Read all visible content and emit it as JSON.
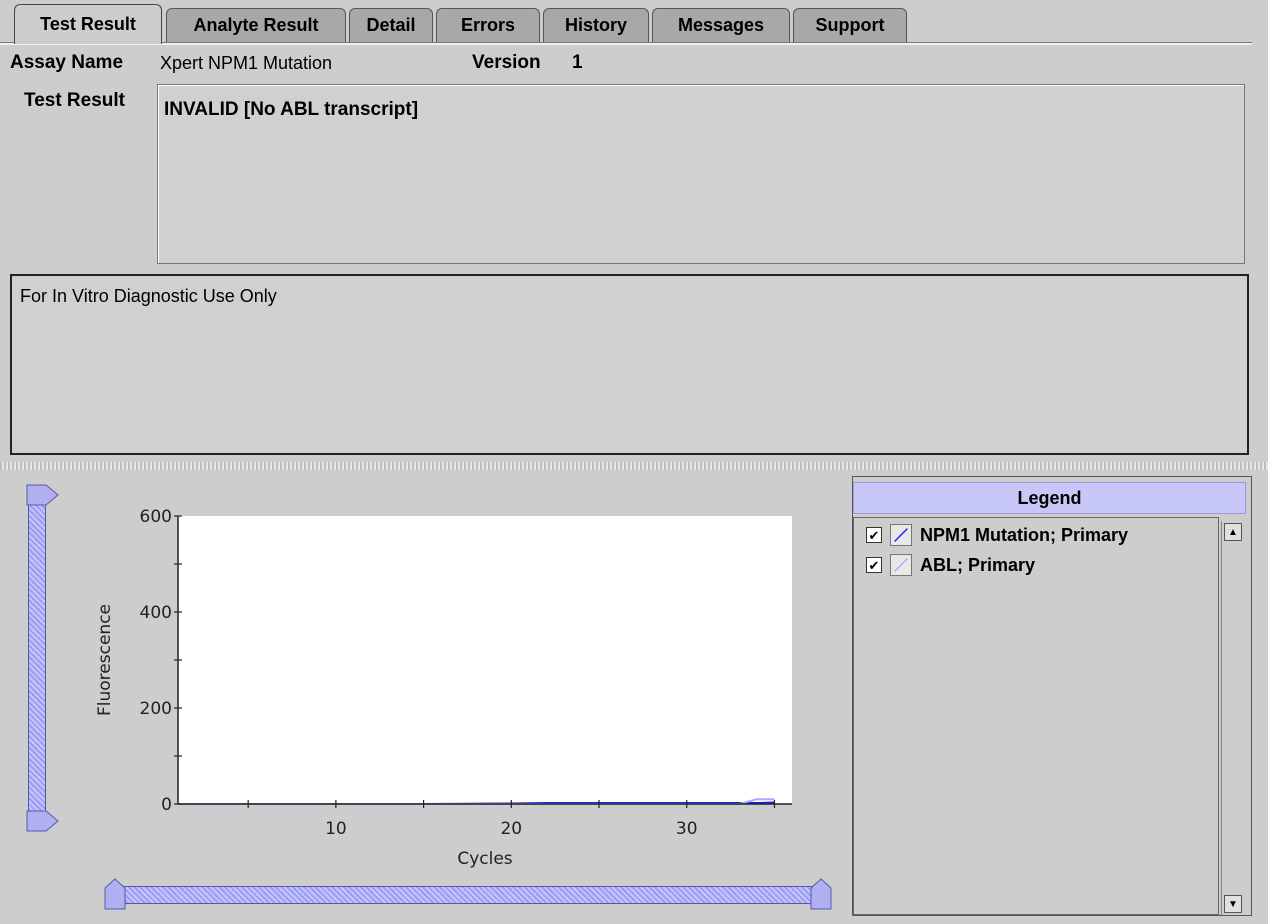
{
  "tabs": [
    {
      "label": "Test Result",
      "active": true
    },
    {
      "label": "Analyte Result",
      "active": false
    },
    {
      "label": "Detail",
      "active": false
    },
    {
      "label": "Errors",
      "active": false
    },
    {
      "label": "History",
      "active": false
    },
    {
      "label": "Messages",
      "active": false
    },
    {
      "label": "Support",
      "active": false
    }
  ],
  "assay": {
    "name_label": "Assay Name",
    "name_value": "Xpert NPM1 Mutation",
    "version_label": "Version",
    "version_value": "1"
  },
  "test_result": {
    "label": "Test Result",
    "value": "INVALID [No ABL transcript]"
  },
  "note": "For In Vitro Diagnostic Use Only",
  "legend": {
    "title": "Legend",
    "items": [
      {
        "label": "NPM1 Mutation; Primary",
        "checked": true,
        "color": "#1a1aff"
      },
      {
        "label": "ABL; Primary",
        "checked": true,
        "color": "#a9a9ff"
      }
    ]
  },
  "chart_data": {
    "type": "line",
    "xlabel": "Cycles",
    "ylabel": "Fluorescence",
    "xlim": [
      1,
      36
    ],
    "ylim": [
      0,
      600
    ],
    "xticks": [
      10,
      20,
      30
    ],
    "yticks": [
      0,
      200,
      400,
      600
    ],
    "grid": false,
    "series": [
      {
        "name": "NPM1 Mutation; Primary",
        "color": "#1a1aff",
        "x": [
          1,
          5,
          10,
          15,
          20,
          22,
          25,
          28,
          30,
          33,
          34,
          35
        ],
        "y": [
          0,
          0,
          0,
          0,
          1,
          2,
          2,
          2,
          2,
          2,
          2,
          3
        ]
      },
      {
        "name": "ABL; Primary",
        "color": "#a9a9ff",
        "x": [
          1,
          5,
          10,
          15,
          20,
          25,
          30,
          33,
          34,
          35
        ],
        "y": [
          0,
          0,
          0,
          0,
          0,
          0,
          0,
          0,
          10,
          10
        ]
      }
    ]
  }
}
